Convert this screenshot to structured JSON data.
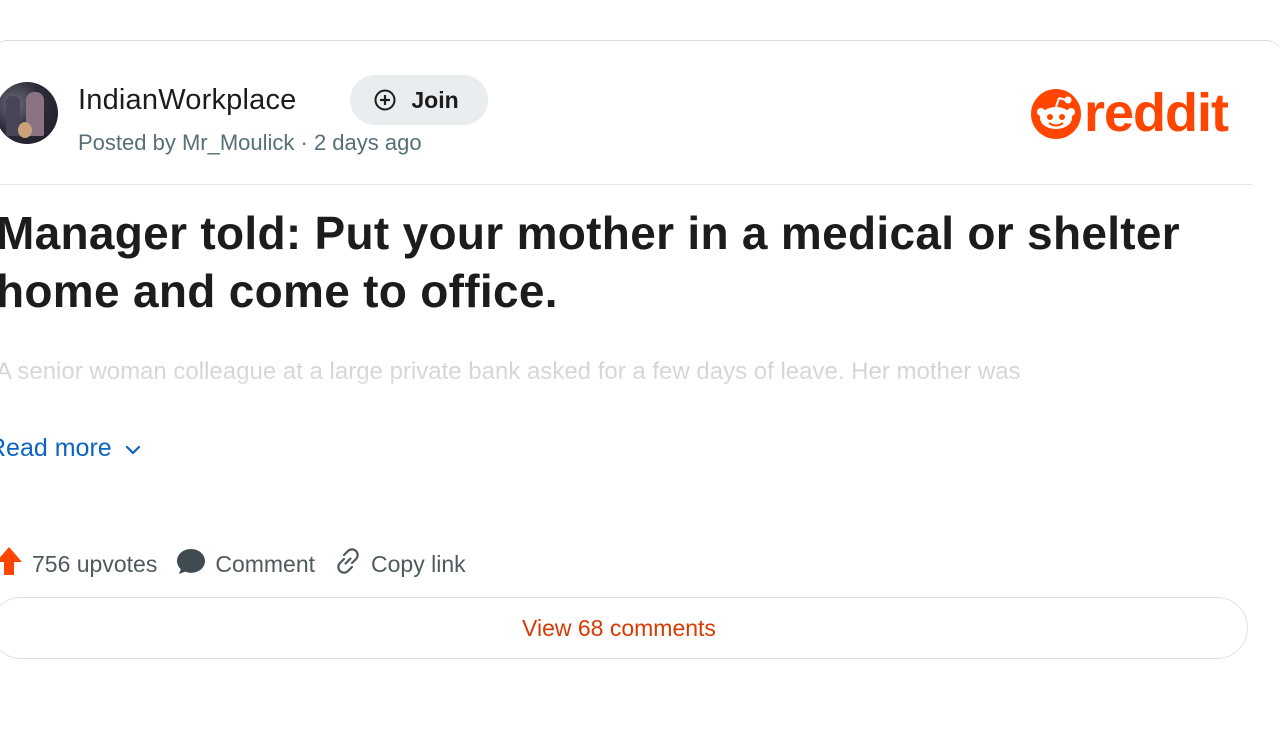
{
  "post": {
    "subreddit": "IndianWorkplace",
    "join_label": "Join",
    "meta": "Posted by Mr_Moulick · 2 days ago",
    "title": "Manager told: Put your mother in a medical or shelter home and come to office.",
    "body_preview": "A senior woman colleague at a large private bank asked for a few days of leave. Her mother was",
    "read_more_label": "Read more"
  },
  "brand": {
    "logo_text": "reddit",
    "color": "#ff4500"
  },
  "actions": {
    "upvotes_label": "756 upvotes",
    "comment_label": "Comment",
    "copy_link_label": "Copy link"
  },
  "footer": {
    "view_comments_label": "View 68 comments"
  },
  "colors": {
    "accent_link": "#0b63c4",
    "comments_link": "#d93a00",
    "title_text": "#1c1c1c"
  },
  "icons": {
    "join": "plus-circle-icon",
    "upvote": "upvote-arrow-icon",
    "comment": "comment-bubble-icon",
    "copy_link": "link-icon",
    "read_more": "chevron-down-icon",
    "logo": "reddit-snoo-icon"
  }
}
